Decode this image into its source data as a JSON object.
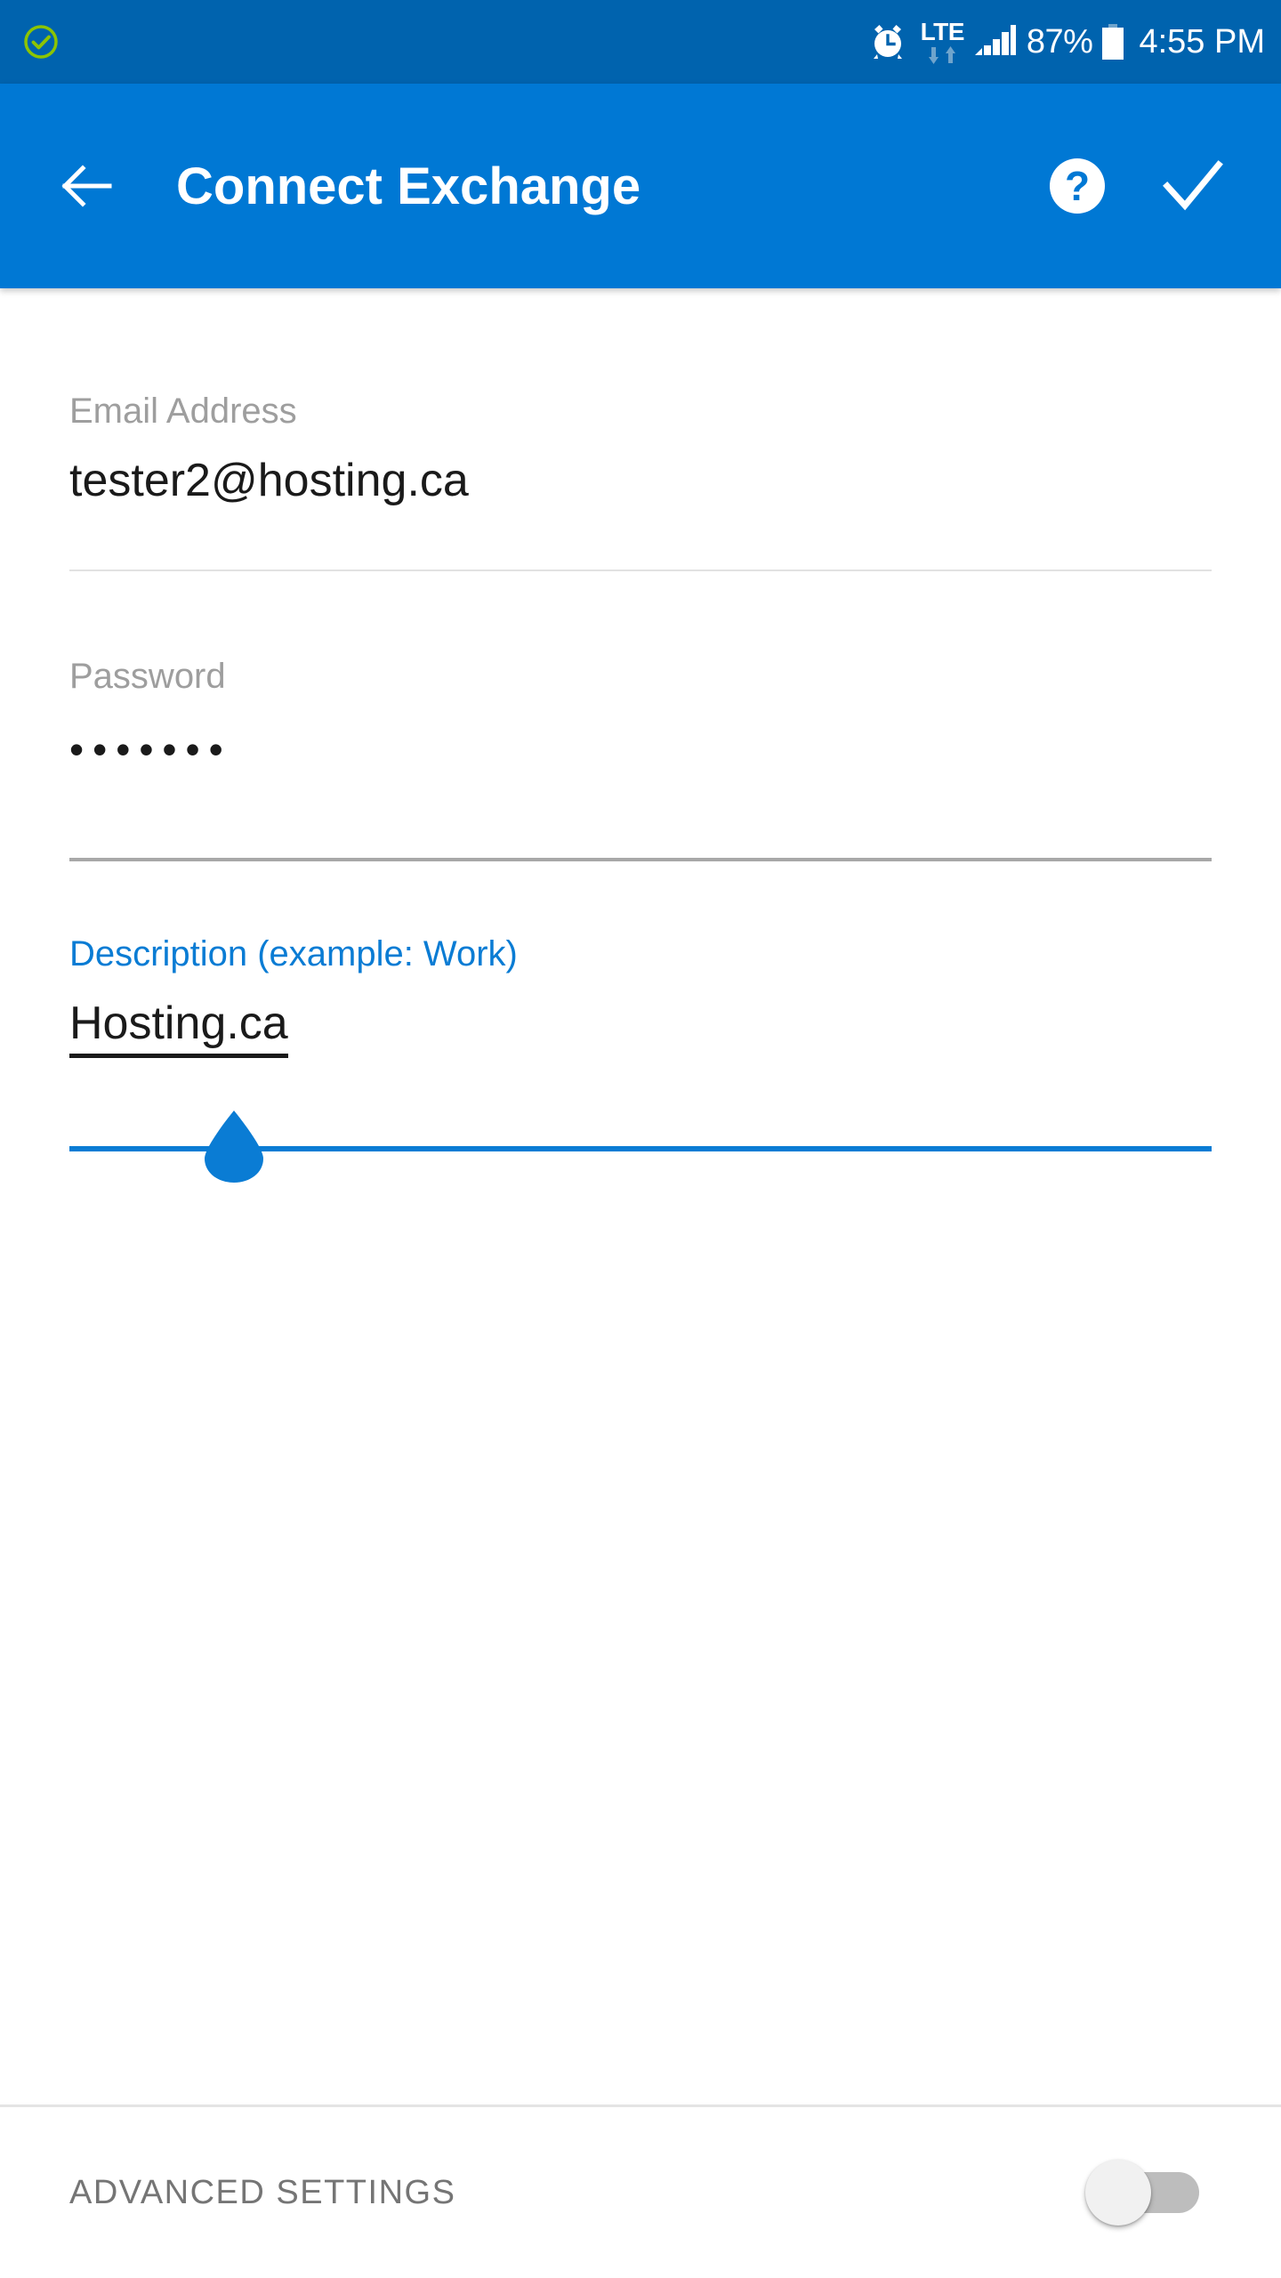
{
  "status_bar": {
    "left_icon": "check-circle-icon",
    "alarm_icon": "alarm-clock-icon",
    "network_type": "LTE",
    "data_arrows_icon": "data-transfer-arrows-icon",
    "signal_icon": "signal-bars-icon",
    "battery_percent": "87%",
    "battery_icon": "battery-icon",
    "time": "4:55 PM",
    "bg_color": "#0063AE"
  },
  "app_bar": {
    "back_icon": "back-arrow-icon",
    "title": "Connect Exchange",
    "help_icon": "help-circle-icon",
    "done_icon": "checkmark-icon",
    "bg_color": "#0078D4"
  },
  "form": {
    "fields": [
      {
        "name": "email",
        "label": "Email Address",
        "value": "tester2@hosting.ca",
        "placeholder": "Email Address",
        "focused": false
      },
      {
        "name": "password",
        "label": "Password",
        "value": "•••••••",
        "placeholder": "Password",
        "focused": false
      },
      {
        "name": "description",
        "label": "Description (example: Work)",
        "value": "Hosting.ca",
        "placeholder": "Description (example: Work)",
        "focused": true
      }
    ],
    "cursor_handle_icon": "text-cursor-handle-icon",
    "accent_color": "#0A7CD4"
  },
  "bottom": {
    "advanced_settings_label": "ADVANCED SETTINGS",
    "toggle_state": "off",
    "toggle_name": "advanced-settings-toggle"
  }
}
